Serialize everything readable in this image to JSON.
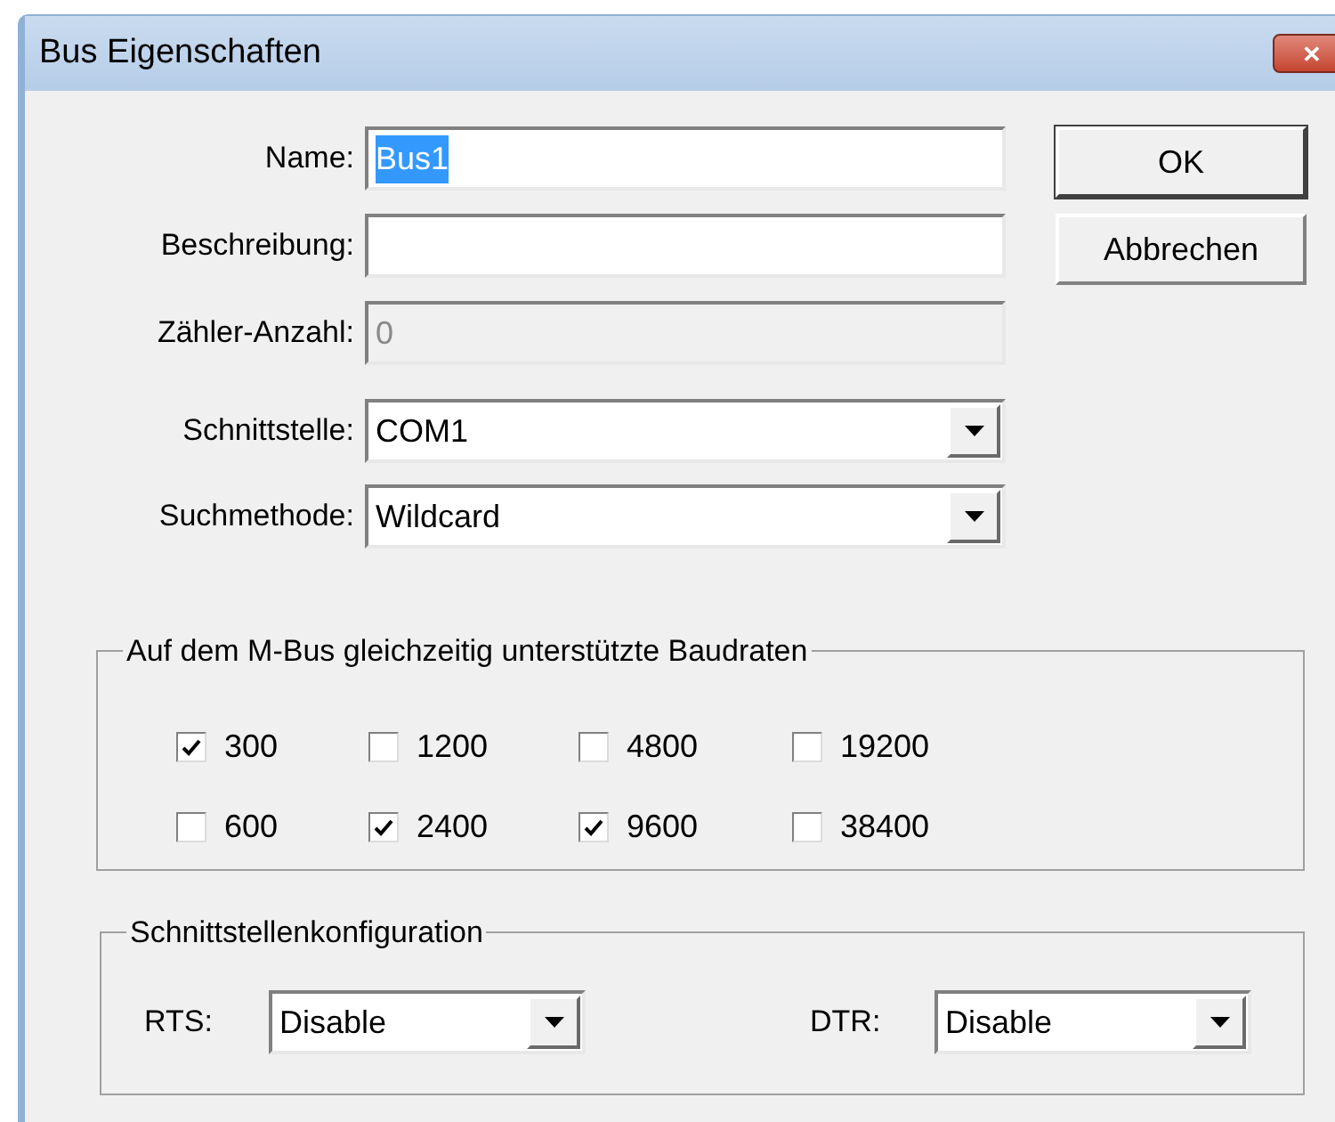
{
  "window": {
    "title": "Bus Eigenschaften",
    "close_label": "✕"
  },
  "fields": [
    {
      "kind": "text",
      "label": "Name:",
      "value": "Bus1",
      "text_selected": true,
      "disabled": false
    },
    {
      "kind": "text",
      "label": "Beschreibung:",
      "disabled": false
    },
    {
      "kind": "text",
      "label": "Zähler-Anzahl:",
      "value": "0",
      "disabled": true
    },
    {
      "kind": "combo",
      "label": "Schnittstelle:",
      "value": "COM1"
    },
    {
      "kind": "combo",
      "label": "Suchmethode:",
      "value": "Wildcard"
    }
  ],
  "buttons": [
    "OK",
    "Abbrechen"
  ],
  "baud_group": {
    "title": "Auf dem M-Bus gleichzeitig unterstützte Baudraten",
    "rates": [
      {
        "label": "300",
        "checked": true
      },
      {
        "label": "1200",
        "checked": false
      },
      {
        "label": "4800",
        "checked": false
      },
      {
        "label": "19200",
        "checked": false
      },
      {
        "label": "600",
        "checked": false
      },
      {
        "label": "2400",
        "checked": true
      },
      {
        "label": "9600",
        "checked": true
      },
      {
        "label": "38400",
        "checked": false
      }
    ]
  },
  "config_group": {
    "title": "Schnittstellenkonfiguration",
    "combos": [
      {
        "label": "RTS:",
        "value": "Disable"
      },
      {
        "label": "DTR:",
        "value": "Disable"
      }
    ]
  }
}
